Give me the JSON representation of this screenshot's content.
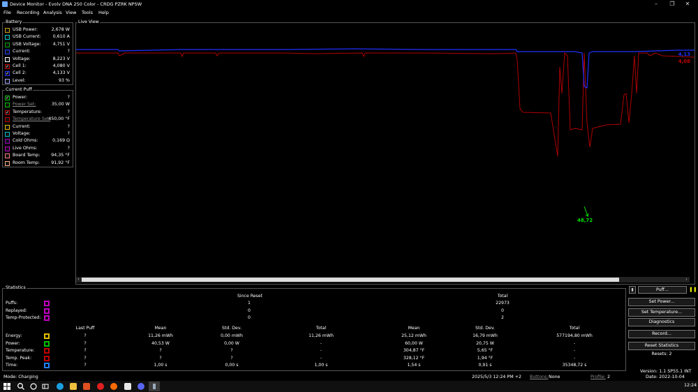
{
  "window": {
    "title": "Device Monitor - Evolv DNA 250 Color - CRDG PZRK NPSW",
    "minimize": "–",
    "maximize": "❐",
    "close": "✕"
  },
  "menu": [
    "File",
    "Recording",
    "Analysis",
    "View",
    "Tools",
    "Help"
  ],
  "battery": {
    "label": "Battery",
    "rows": [
      {
        "label": "USB Power:",
        "value": "2,678 W",
        "color": "#c8a000",
        "checked": false
      },
      {
        "label": "USB Current:",
        "value": "0,610 A",
        "color": "#00c8c8",
        "checked": false
      },
      {
        "label": "USB Voltage:",
        "value": "4,751 V",
        "color": "#00a000",
        "checked": false
      },
      {
        "label": "Current:",
        "value": "?",
        "color": "#2040ff",
        "checked": false
      },
      {
        "label": "Voltage:",
        "value": "8,223 V",
        "color": "#ffffff",
        "checked": false
      },
      {
        "label": "Cell 1:",
        "value": "4,080 V",
        "color": "#c00000",
        "checked": true
      },
      {
        "label": "Cell 2:",
        "value": "4,133 V",
        "color": "#2030ff",
        "checked": true
      },
      {
        "label": "Level:",
        "value": "93 %",
        "color": "#a0a0ff",
        "checked": false
      }
    ]
  },
  "current_puff": {
    "label": "Current Puff",
    "rows": [
      {
        "label": "Power:",
        "value": "?",
        "color": "#00c000",
        "checked": true,
        "dim": false
      },
      {
        "label": "Power Set:",
        "value": "35,00 W",
        "color": "#00c000",
        "checked": false,
        "dim": true
      },
      {
        "label": "Temperature:",
        "value": "?",
        "color": "#c00000",
        "checked": true,
        "dim": false
      },
      {
        "label": "Temperature Set:",
        "value": "450,00 °F",
        "color": "#c00000",
        "checked": false,
        "dim": true
      },
      {
        "label": "Current:",
        "value": "?",
        "color": "#e0c000",
        "checked": false,
        "dim": false
      },
      {
        "label": "Voltage:",
        "value": "?",
        "color": "#00c0c0",
        "checked": false,
        "dim": false
      },
      {
        "label": "Cold Ohms:",
        "value": "0,169 Ω",
        "color": "#a000c0",
        "checked": false,
        "dim": false
      },
      {
        "label": "Live Ohms:",
        "value": "?",
        "color": "#c000c0",
        "checked": false,
        "dim": false
      },
      {
        "label": "Board Temp:",
        "value": "94,35 °F",
        "color": "#ff8080",
        "checked": false,
        "dim": false
      },
      {
        "label": "Room Temp:",
        "value": "91,92 °F",
        "color": "#ffb080",
        "checked": false,
        "dim": false
      }
    ]
  },
  "live_view": {
    "label": "Live View",
    "blue_value": "4,13",
    "red_value": "4,08",
    "green_value": "48,72",
    "colors": {
      "blue": "#2030ff",
      "red": "#b00000",
      "green": "#00e000"
    }
  },
  "statistics": {
    "label": "Statistics",
    "since_reset_header": "Since Reset",
    "total_header": "Total",
    "top_rows": [
      {
        "label": "Puffs:",
        "since": "1",
        "total": "22973",
        "color": "#c000c0"
      },
      {
        "label": "Replayed:",
        "since": "0",
        "total": "0",
        "color": "#c000c0"
      },
      {
        "label": "Temp-Protected:",
        "since": "0",
        "total": "2",
        "color": "#c000c0"
      }
    ],
    "columns": [
      "Last Puff",
      "Mean",
      "Std. Dev.",
      "Total",
      "Mean",
      "Std. Dev.",
      "Total"
    ],
    "rows": [
      {
        "label": "Energy:",
        "color": "#e0c000",
        "values": [
          "?",
          "11,26 mWh",
          "0,00 mWh",
          "11,26 mWh",
          "25,12 mWh",
          "16,79 mWh",
          "577194,80 mWh"
        ]
      },
      {
        "label": "Power:",
        "color": "#00c000",
        "values": [
          "?",
          "40,53 W",
          "0,00 W",
          "-",
          "60,00 W",
          "20,75 W",
          "-"
        ]
      },
      {
        "label": "Temperature:",
        "color": "#c00000",
        "values": [
          "?",
          "?",
          "?",
          "-",
          "304,87 °F",
          "5,65 °F",
          "-"
        ]
      },
      {
        "label": "Temp. Peak:",
        "color": "#c00000",
        "values": [
          "?",
          "?",
          "?",
          "-",
          "328,12 °F",
          "1,94 °F",
          "-"
        ]
      },
      {
        "label": "Time:",
        "color": "#2080ff",
        "values": [
          "?",
          "1,00 s",
          "0,00 s",
          "1,00 s",
          "1,54 s",
          "0,91 s",
          "35348,72 s"
        ]
      }
    ]
  },
  "buttons": {
    "puff": "Puff...",
    "set_power": "Set Power...",
    "set_temperature": "Set Temperature...",
    "diagnostics": "Diagnostics",
    "record": "Record...",
    "reset_statistics": "Reset Statistics",
    "resets": "Resets: 2"
  },
  "status": {
    "mode": "Mode: Charging",
    "datetime": "2025/5/3 12:24 PM +2",
    "buttons_label": "Buttons:",
    "buttons_value": "None",
    "profile_label": "Profile:",
    "profile_value": "2",
    "version": "Version: 1.1 SP55.1 INT",
    "date": "Date: 2022-10-04"
  },
  "taskbar": {
    "clock": "12:24"
  }
}
